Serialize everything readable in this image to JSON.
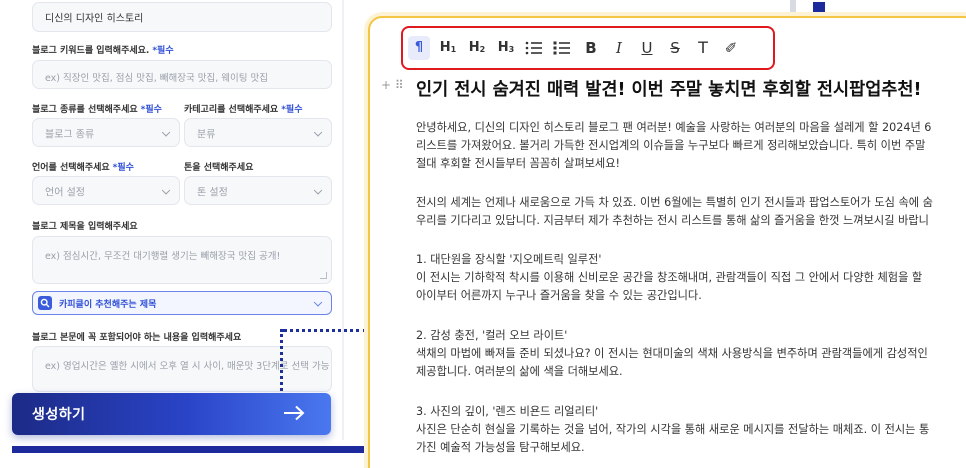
{
  "form": {
    "brand_value": "디신의 디자인 히스토리",
    "keyword_label": "블로그 키워드를 입력해주세요.",
    "keyword_required": "*필수",
    "keyword_placeholder": "ex) 직장인 맛집, 점심 맛집, 빼해장국 맛집, 웨이팅 맛집",
    "blog_type_label": "블로그 종류를 선택해주세요",
    "blog_type_required": "*필수",
    "blog_type_value": "블로그 종류",
    "category_label": "카테고리를 선택해주세요",
    "category_required": "*필수",
    "category_value": "분류",
    "language_label": "언어를 선택해주세요",
    "language_required": "*필수",
    "language_value": "언어 설정",
    "tone_label": "톤을 선택해주세요",
    "tone_value": "톤 설정",
    "title_label": "블로그 제목을 입력해주세요",
    "title_placeholder": "ex) 점심시간, 무조건 대기행렬 생기는 빼해장국 맛집 공개!",
    "suggest_label": "카피클이 추천해주는 제목",
    "content_label": "블로그 본문에 꼭 포함되어야 하는 내용을 입력해주세요",
    "content_placeholder": "ex) 영업시간은 옐한 시에서 오후 열 시 사이, 매운맛 3단계로 선택 가능",
    "generate_label": "생성하기",
    "generate_arrow": "→"
  },
  "toolbar": {
    "paragraph": "¶",
    "h1": "H",
    "h1_sub": "1",
    "h2": "H",
    "h2_sub": "2",
    "h3": "H",
    "h3_sub": "3",
    "bullet_list": "☰",
    "ordered_list": "☷",
    "bold": "B",
    "italic": "I",
    "underline": "U",
    "strike": "S",
    "text": "T",
    "clear_format": "✐"
  },
  "editor": {
    "gutter": "+ ⠿",
    "title": "인기 전시 숨겨진 매력 발견! 이번 주말 놓치면 후회할 전시팝업추천!",
    "p1_l1": "안녕하세요, 디신의 디자인 히스토리 블로그 팬 여러분! 예술을 사랑하는 여러분의 마음을 설레게 할 2024년 6",
    "p1_l2": "리스트를 가져왔어요. 볼거리 가득한 전시업계의 이슈들을 누구보다 빠르게 정리해보았습니다. 특히 이번 주말",
    "p1_l3": "절대 후회할 전시들부터 꼼꼼히 살펴보세요!",
    "p2_l1": "전시의 세계는 언제나 새로움으로 가득 차 있죠. 이번 6월에는 특별히 인기 전시들과 팝업스토어가 도심 속에 숨",
    "p2_l2": "우리를 기다리고 있답니다. 지금부터 제가 추천하는 전시 리스트를 통해 삶의 즐거움을 한껏 느껴보시길 바랍니",
    "s1_head": "1. 대단원을 장식할 '지오메트릭 일루전'",
    "s1_l1": "이 전시는 기하학적 착시를 이용해 신비로운 공간을 창조해내며, 관람객들이 직접 그 안에서 다양한 체험을 할",
    "s1_l2": "아이부터 어른까지 누구나 즐거움을 찾을 수 있는 공간입니다.",
    "s2_head": "2. 감성 충전, '컬러 오브 라이트'",
    "s2_l1": "색채의 마법에 빠져들 준비 되셨나요? 이 전시는 현대미술의 색채 사용방식을 변주하며 관람객들에게 감성적인",
    "s2_l2": "제공합니다. 여러분의 삶에 색을 더해보세요.",
    "s3_head": "3. 사진의 깊이, '렌즈 비욘드 리얼리티'",
    "s3_l1": "사진은 단순히 현실을 기록하는 것을 넘어, 작가의 시각을 통해 새로운 메시지를 전달하는 매체죠. 이 전시는 통",
    "s3_l2": "가진 예술적 가능성을 탐구해보세요."
  },
  "colors": {
    "accent_blue": "#2f4fd6",
    "highlight_red": "#e0191f",
    "frame_yellow": "#f4c542",
    "navy": "#1c2a9c"
  }
}
